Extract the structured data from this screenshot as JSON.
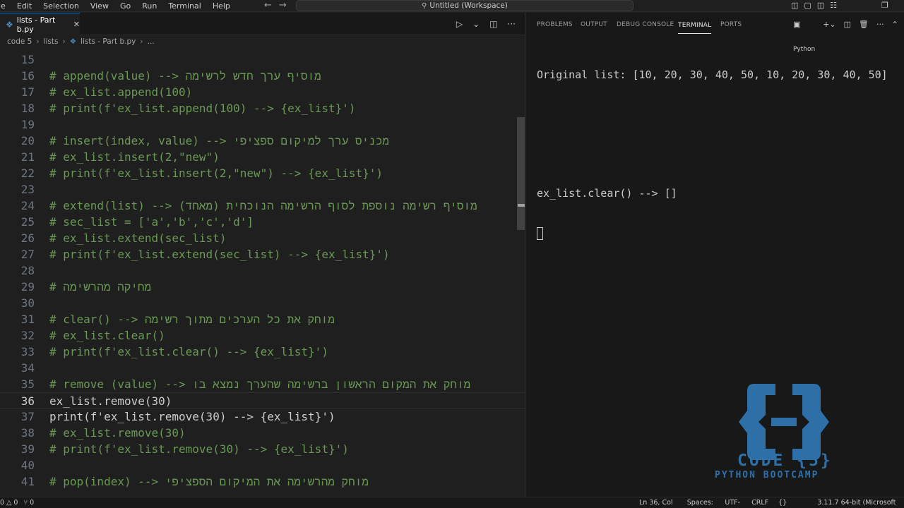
{
  "menu": [
    "le",
    "Edit",
    "Selection",
    "View",
    "Go",
    "Run",
    "Terminal",
    "Help"
  ],
  "command_center": "Untitled (Workspace)",
  "editor": {
    "tab_label": "lists - Part b.py",
    "breadcrumb": [
      "code 5",
      "lists",
      "lists - Part b.py",
      "..."
    ],
    "lines": [
      {
        "n": "15",
        "t": "",
        "k": "code"
      },
      {
        "n": "16",
        "t": "# append(value) --> מוסיף ערך חדש לרשימה",
        "k": "comment"
      },
      {
        "n": "17",
        "t": "# ex_list.append(100)",
        "k": "comment"
      },
      {
        "n": "18",
        "t": "# print(f'ex_list.append(100) --> {ex_list}')",
        "k": "comment"
      },
      {
        "n": "19",
        "t": "",
        "k": "code"
      },
      {
        "n": "20",
        "t": "# insert(index, value) --> מכניס ערך למיקום ספציפי",
        "k": "comment"
      },
      {
        "n": "21",
        "t": "# ex_list.insert(2,\"new\")",
        "k": "comment"
      },
      {
        "n": "22",
        "t": "# print(f'ex_list.insert(2,\"new\") --> {ex_list}')",
        "k": "comment"
      },
      {
        "n": "23",
        "t": "",
        "k": "code"
      },
      {
        "n": "24",
        "t": "# extend(list) --> (מאחד) מוסיף רשימה נוספת לסוף הרשימה הנוכחית",
        "k": "comment"
      },
      {
        "n": "25",
        "t": "# sec_list = ['a','b','c','d']",
        "k": "comment"
      },
      {
        "n": "26",
        "t": "# ex_list.extend(sec_list)",
        "k": "comment"
      },
      {
        "n": "27",
        "t": "# print(f'ex_list.extend(sec_list) --> {ex_list}')",
        "k": "comment"
      },
      {
        "n": "28",
        "t": "",
        "k": "code"
      },
      {
        "n": "29",
        "t": "# מחיקה מהרשימה",
        "k": "comment"
      },
      {
        "n": "30",
        "t": "",
        "k": "code"
      },
      {
        "n": "31",
        "t": "# clear() --> מוחק את כל הערכים מתוך רשימה",
        "k": "comment"
      },
      {
        "n": "32",
        "t": "# ex_list.clear()",
        "k": "comment"
      },
      {
        "n": "33",
        "t": "# print(f'ex_list.clear() --> {ex_list}')",
        "k": "comment"
      },
      {
        "n": "34",
        "t": "",
        "k": "code"
      },
      {
        "n": "35",
        "t": "# remove (value) --> מוחק את המקום הראשון ברשימה שהערך נמצא בו",
        "k": "comment"
      },
      {
        "n": "36",
        "t": "ex_list.remove(30)",
        "k": "code"
      },
      {
        "n": "37",
        "t": "print(f'ex_list.remove(30) --> {ex_list}')",
        "k": "code"
      },
      {
        "n": "38",
        "t": "# ex_list.remove(30)",
        "k": "comment"
      },
      {
        "n": "39",
        "t": "# print(f'ex_list.remove(30) --> {ex_list}')",
        "k": "comment"
      },
      {
        "n": "40",
        "t": "",
        "k": "code"
      },
      {
        "n": "41",
        "t": "# pop(index) --> מוחק מהרשימה את המיקום הספציפי",
        "k": "comment"
      }
    ],
    "active_line": "36"
  },
  "panel": {
    "tabs": [
      "PROBLEMS",
      "OUTPUT",
      "DEBUG CONSOLE",
      "TERMINAL",
      "PORTS"
    ],
    "active_tab": "TERMINAL",
    "terminal_profile": "Python",
    "terminal_lines": [
      "Original list: [10, 20, 30, 40, 50, 10, 20, 30, 40, 50]",
      "",
      "",
      "ex_list.clear() --> []"
    ]
  },
  "logo": {
    "line1": "CODE {5}",
    "line2": "PYTHON BOOTCAMP"
  },
  "status": {
    "left": [
      "0 △ 0",
      "⑂ 0"
    ],
    "right": [
      "Ln 36, Col 16",
      "Spaces: 4",
      "UTF-8",
      "CRLF",
      "{} Python",
      "3.11.7 64-bit (Microsoft Store)"
    ]
  }
}
